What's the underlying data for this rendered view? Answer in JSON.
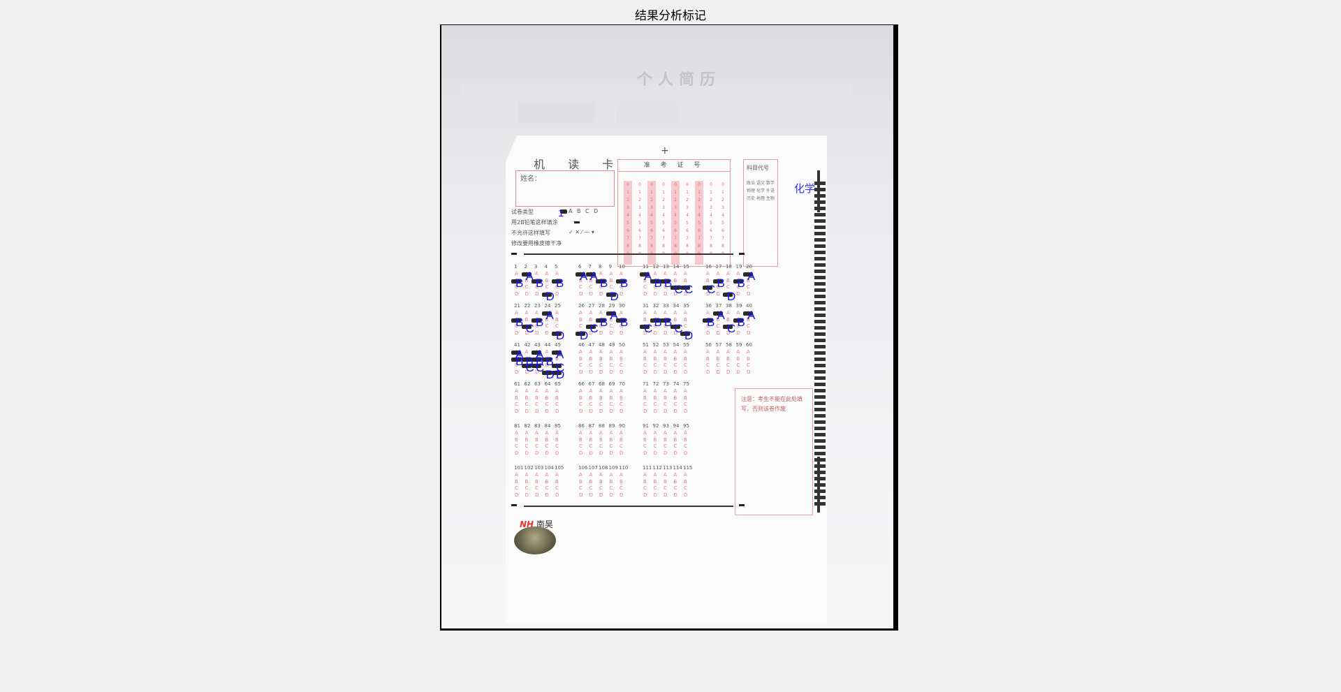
{
  "window": {
    "title": "结果分析标记"
  },
  "colors": {
    "annotation": "#1616ee",
    "card_red": "#d86a74",
    "background": "#f0f0f0"
  },
  "photo_background": {
    "header_text": "个人简历"
  },
  "card": {
    "title": "机 读 卡",
    "name_label": "姓名：",
    "instructions": [
      "试卷类型",
      "用2B铅笔这样填涂",
      "不允许这样填写",
      "修改要用橡皮擦干净"
    ],
    "paper_type_options": [
      "A",
      "B",
      "C",
      "D"
    ],
    "exam_number_header": "准 考 证 号",
    "exam_digits": [
      "0",
      "1",
      "2",
      "3",
      "4",
      "5",
      "6",
      "7",
      "8",
      "9"
    ],
    "subject_header": "科目代号",
    "subjects": [
      "政治",
      "语文",
      "数学",
      "物理",
      "化学",
      "外语",
      "历史",
      "地理",
      "生物"
    ],
    "right_box_note": "注意：考生不能在此处填写，否则该卷作废",
    "brand": "南昊",
    "brand_logo": "NH"
  },
  "result": {
    "paper_type": "1",
    "subject": "化学",
    "answers": [
      {
        "q": 1,
        "a": "B"
      },
      {
        "q": 2,
        "a": "A"
      },
      {
        "q": 3,
        "a": "B"
      },
      {
        "q": 4,
        "a": "D"
      },
      {
        "q": 5,
        "a": "B"
      },
      {
        "q": 6,
        "a": "A"
      },
      {
        "q": 7,
        "a": "A"
      },
      {
        "q": 8,
        "a": "B"
      },
      {
        "q": 9,
        "a": "D"
      },
      {
        "q": 10,
        "a": "B"
      },
      {
        "q": 11,
        "a": "A"
      },
      {
        "q": 12,
        "a": "B"
      },
      {
        "q": 13,
        "a": "B"
      },
      {
        "q": 14,
        "a": "C"
      },
      {
        "q": 15,
        "a": "C"
      },
      {
        "q": 16,
        "a": "C"
      },
      {
        "q": 17,
        "a": "B"
      },
      {
        "q": 18,
        "a": "D"
      },
      {
        "q": 19,
        "a": "B"
      },
      {
        "q": 20,
        "a": "A"
      },
      {
        "q": 21,
        "a": "B"
      },
      {
        "q": 22,
        "a": "C"
      },
      {
        "q": 23,
        "a": "B"
      },
      {
        "q": 24,
        "a": "A"
      },
      {
        "q": 25,
        "a": "D"
      },
      {
        "q": 26,
        "a": "D"
      },
      {
        "q": 27,
        "a": "C"
      },
      {
        "q": 28,
        "a": "B"
      },
      {
        "q": 29,
        "a": "A"
      },
      {
        "q": 30,
        "a": "B"
      },
      {
        "q": 31,
        "a": "C"
      },
      {
        "q": 32,
        "a": "B"
      },
      {
        "q": 33,
        "a": "B"
      },
      {
        "q": 34,
        "a": "C"
      },
      {
        "q": 35,
        "a": "D"
      },
      {
        "q": 36,
        "a": "B"
      },
      {
        "q": 37,
        "a": "A"
      },
      {
        "q": 38,
        "a": "C"
      },
      {
        "q": 39,
        "a": "B"
      },
      {
        "q": 40,
        "a": "A"
      },
      {
        "q": 41,
        "a": "AB"
      },
      {
        "q": 42,
        "a": "BC"
      },
      {
        "q": 43,
        "a": "ABC"
      },
      {
        "q": 44,
        "a": "BD"
      },
      {
        "q": 45,
        "a": "ACD"
      }
    ]
  }
}
